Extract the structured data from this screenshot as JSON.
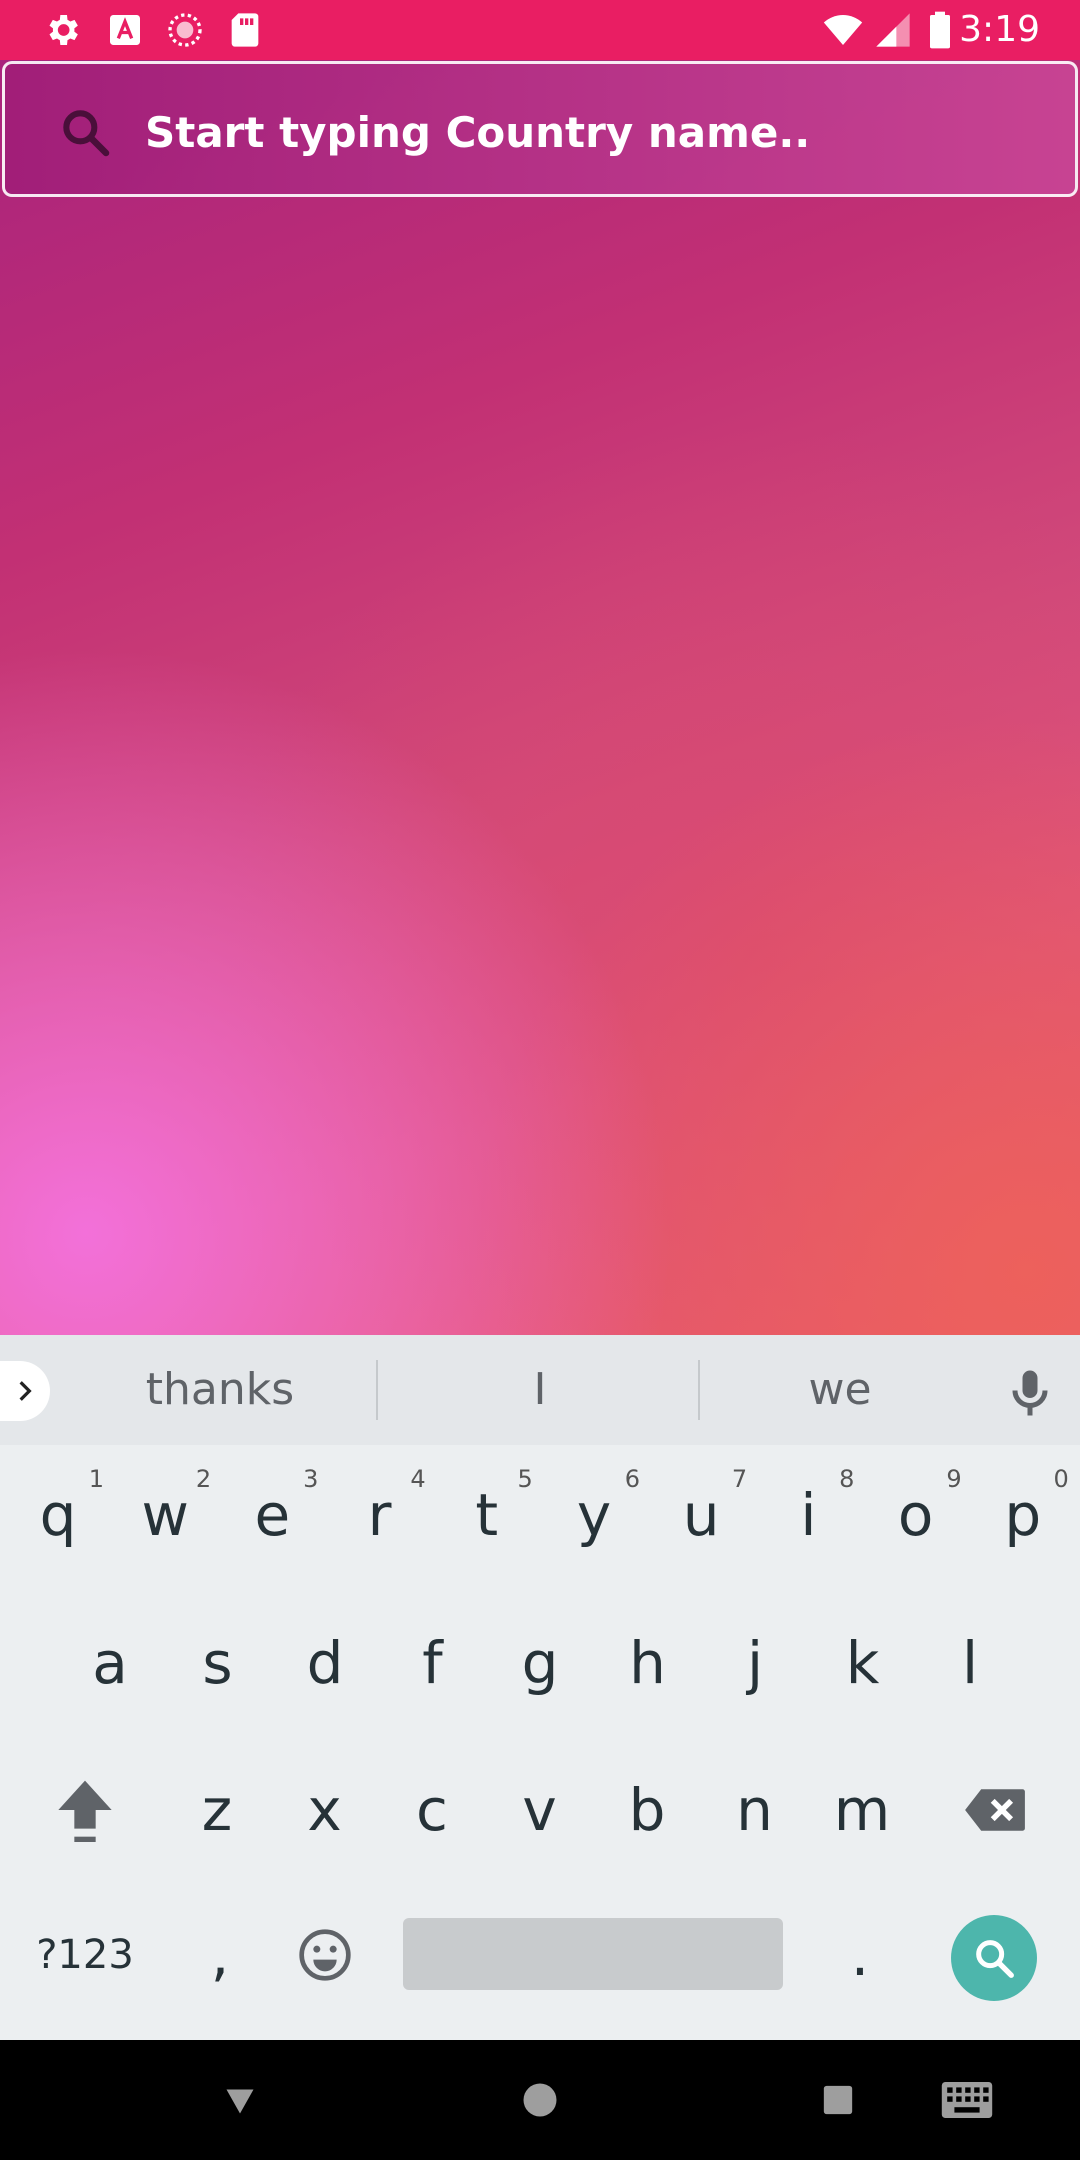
{
  "status_bar": {
    "time": "3:19",
    "left_icons": [
      "gear-icon",
      "font-a-icon",
      "sync-circle-icon",
      "sd-card-icon"
    ],
    "right_icons": [
      "wifi-icon",
      "signal-icon",
      "battery-icon"
    ],
    "color": "#e91e63"
  },
  "search": {
    "placeholder": "Start typing Country name..",
    "icon": "search-icon"
  },
  "keyboard": {
    "suggestions": [
      "thanks",
      "I",
      "we"
    ],
    "row1": [
      {
        "label": "q",
        "hint": "1"
      },
      {
        "label": "w",
        "hint": "2"
      },
      {
        "label": "e",
        "hint": "3"
      },
      {
        "label": "r",
        "hint": "4"
      },
      {
        "label": "t",
        "hint": "5"
      },
      {
        "label": "y",
        "hint": "6"
      },
      {
        "label": "u",
        "hint": "7"
      },
      {
        "label": "i",
        "hint": "8"
      },
      {
        "label": "o",
        "hint": "9"
      },
      {
        "label": "p",
        "hint": "0"
      }
    ],
    "row2": [
      "a",
      "s",
      "d",
      "f",
      "g",
      "h",
      "j",
      "k",
      "l"
    ],
    "row3": [
      "z",
      "x",
      "c",
      "v",
      "b",
      "n",
      "m"
    ],
    "symbols_label": "?123",
    "comma_label": ",",
    "period_label": ".",
    "action_color": "#4db6ac"
  },
  "nav_bar": {
    "buttons": [
      "back-triangle-icon",
      "home-circle-icon",
      "recents-square-icon",
      "keyboard-icon"
    ]
  }
}
